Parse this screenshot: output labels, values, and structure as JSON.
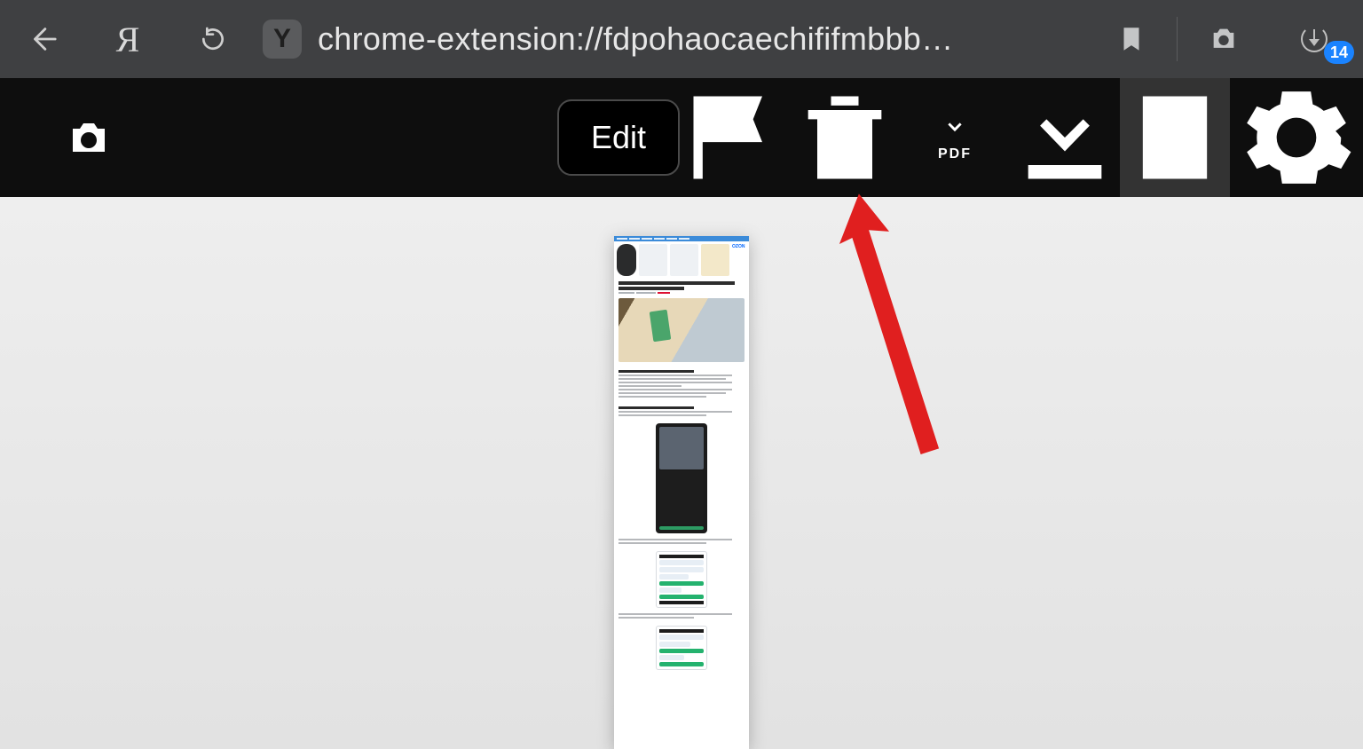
{
  "browser": {
    "url_display": "chrome-extension://fdpohaocaechififmbbb…",
    "site_identity_letter": "Y",
    "yandex_logo_letter": "Я",
    "downloads_badge": "14"
  },
  "toolbar": {
    "edit_label": "Edit",
    "pdf_label": "PDF"
  },
  "icons": {
    "back": "back-arrow",
    "reload": "reload",
    "bookmark": "bookmark",
    "ext_camera": "camera",
    "downloads": "downloads",
    "camera": "camera",
    "flag": "flag",
    "trash": "trash",
    "download_pdf": "download-pdf",
    "download": "download",
    "document": "document",
    "settings": "gear"
  },
  "preview": {
    "brand_text": "OZON",
    "article_title_line1": "Как умная камера от Google помогает делать",
    "article_title_line2": "домашние задания",
    "heading1": "А зачем здесь ОбъектИв?",
    "heading2": "Как ОбъектИв помогает решать задачи"
  },
  "annotation": {
    "arrow_color": "#e01f1f"
  }
}
